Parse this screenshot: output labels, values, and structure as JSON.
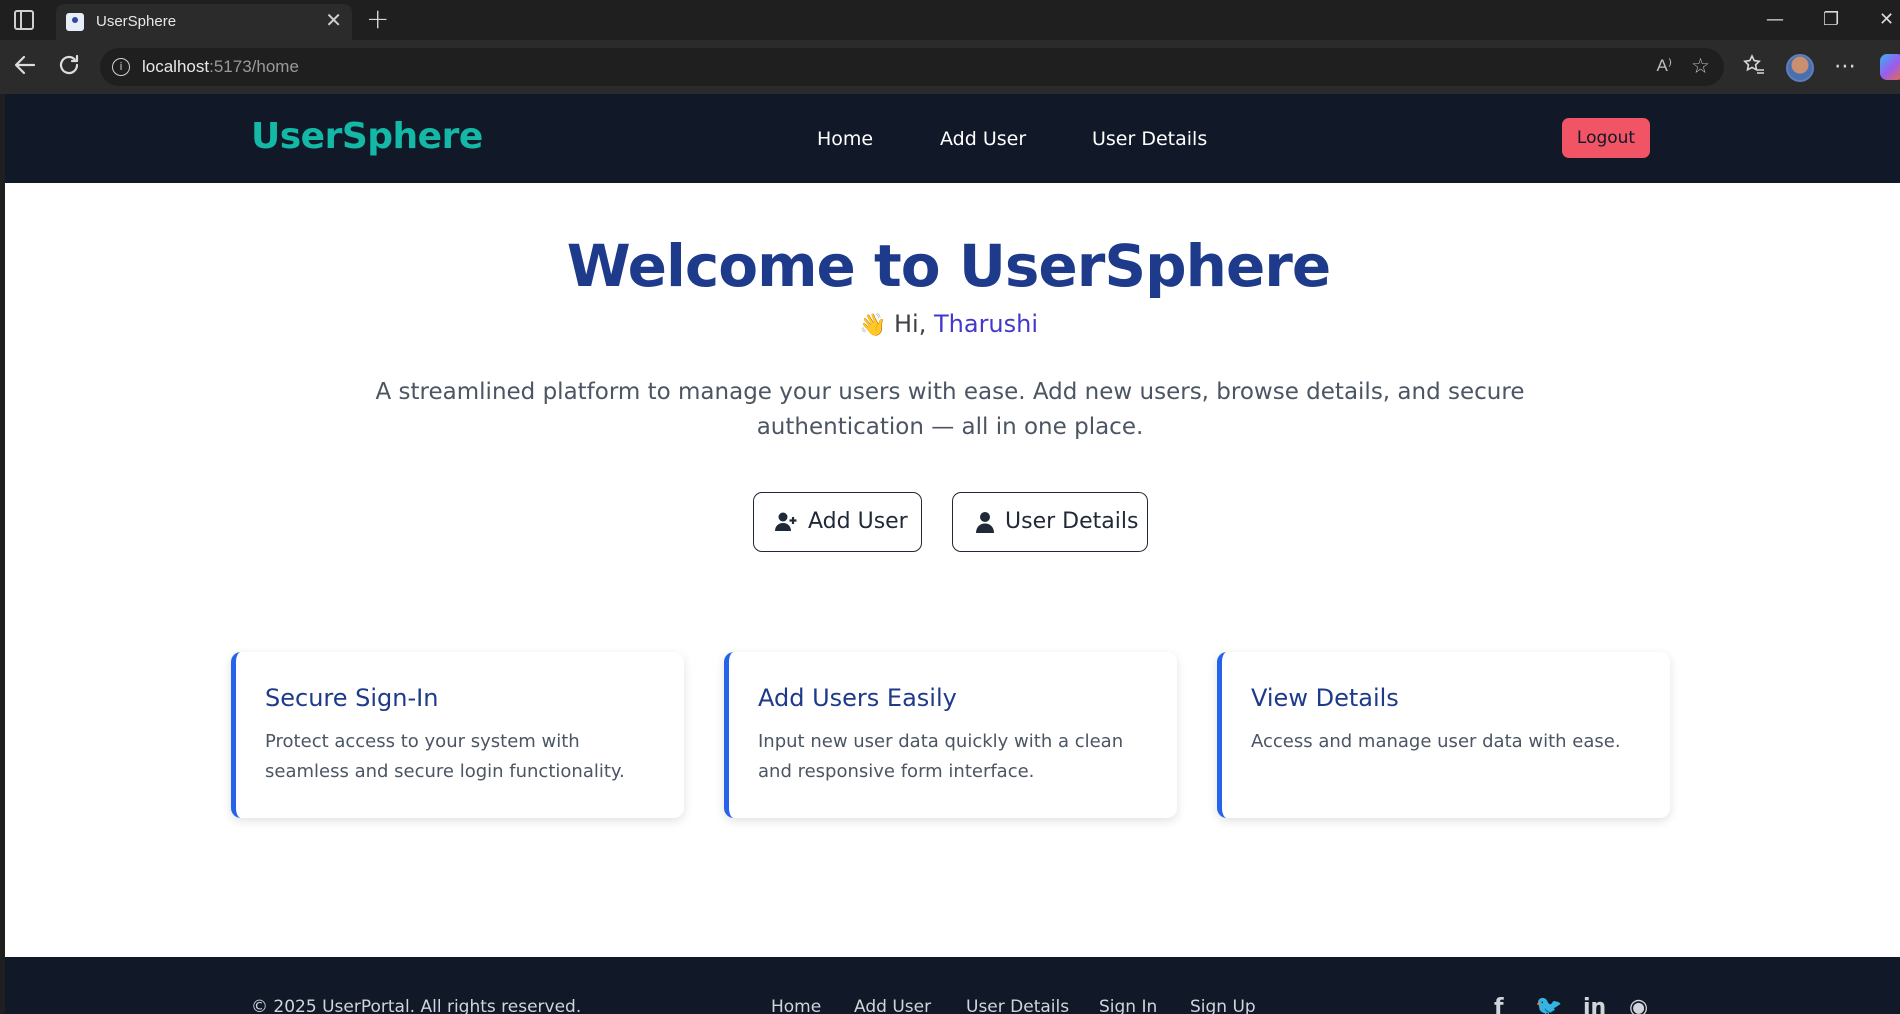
{
  "browser": {
    "tab_title": "UserSphere",
    "tab_close": "✕",
    "new_tab": "+",
    "url_host": "localhost",
    "url_rest": ":5173/home",
    "read_aloud": "A⁾",
    "window_controls": {
      "minimize": "—",
      "restore": "❐",
      "close": "✕"
    },
    "icons": [
      "sidebar-toggle-icon",
      "favicon-icon",
      "back-icon",
      "refresh-icon",
      "info-icon",
      "read-aloud-icon",
      "favorite-star-icon",
      "favorites-icon",
      "more-icon",
      "copilot-icon"
    ]
  },
  "header": {
    "brand": "UserSphere",
    "nav": {
      "home": "Home",
      "add_user": "Add User",
      "user_details": "User Details"
    },
    "logout": "Logout"
  },
  "hero": {
    "title": "Welcome to UserSphere",
    "greeting_wave": "👋",
    "greeting_prefix": "Hi,",
    "user_name": "Tharushi",
    "tagline": "A streamlined platform to manage your users with ease. Add new users, browse details, and secure authentication — all in one place.",
    "add_user_button": "Add User",
    "user_details_button": "User Details"
  },
  "cards": [
    {
      "title": "Secure Sign-In",
      "text": "Protect access to your system with seamless and secure login functionality."
    },
    {
      "title": "Add Users Easily",
      "text": "Input new user data quickly with a clean and responsive form interface."
    },
    {
      "title": "View Details",
      "text": "Access and manage user data with ease."
    }
  ],
  "footer": {
    "copyright": "© 2025 UserPortal. All rights reserved.",
    "links": {
      "home": "Home",
      "add_user": "Add User",
      "user_details": "User Details",
      "sign_in": "Sign In",
      "sign_up": "Sign Up"
    },
    "social": {
      "facebook": "f",
      "twitter": "🐦",
      "linkedin": "in",
      "github": "◉"
    }
  },
  "colors": {
    "header_bg": "#111827",
    "brand": "#14b8a6",
    "hero_title": "#1e3a8a",
    "user_name": "#4338ca",
    "logout_bg": "#f05465",
    "card_accent": "#2563eb"
  }
}
